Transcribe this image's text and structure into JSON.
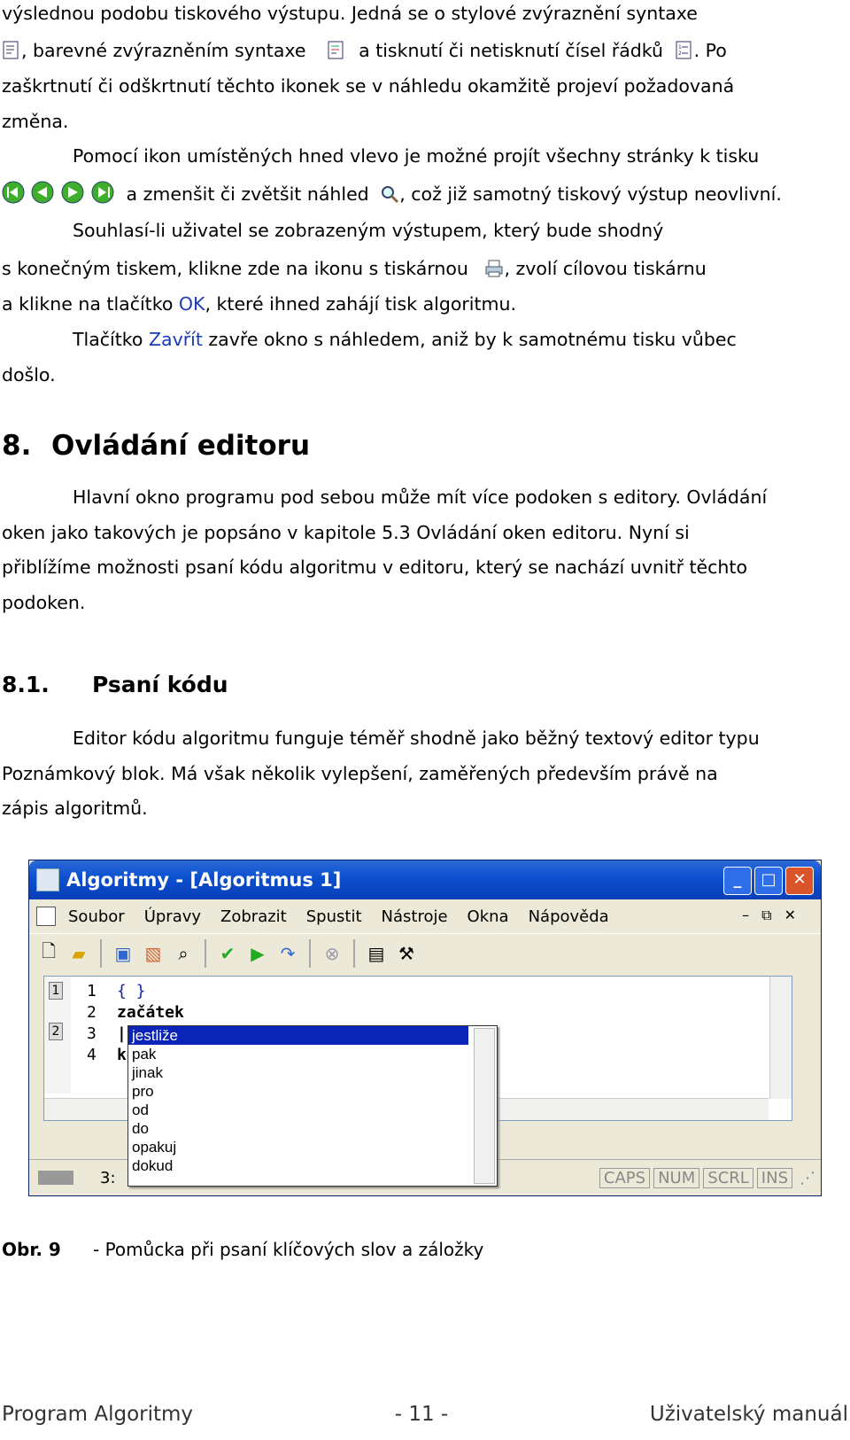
{
  "paragraph_top": {
    "l1": "výslednou podobu tiskového výstupu. Jedná se o stylové zvýraznění syntaxe",
    "l2a": ", barevné zvýrazněním syntaxe",
    "l2b": "a tisknutí či netisknutí čísel řádků",
    "l2c": ". Po",
    "l3": "zaškrtnutí či odškrtnutí těchto ikonek se v náhledu okamžitě projeví požadovaná",
    "l4": "změna."
  },
  "paragraph_pages": {
    "l1": "Pomocí ikon umístěných hned vlevo je možné projít všechny stránky k tisku",
    "l2a": "a zmenšit či zvětšit náhled",
    "l2b": ", což již samotný tiskový výstup neovlivní."
  },
  "paragraph_print": {
    "l1": "Souhlasí-li uživatel se zobrazeným výstupem, který bude shodný",
    "l2a": "s konečným tiskem, klikne zde na ikonu s tiskárnou",
    "l2b": ", zvolí cílovou tiskárnu",
    "l3a": "a klikne na tlačítko ",
    "l3b": "OK",
    "l3c": ", které ihned zahájí tisk algoritmu."
  },
  "paragraph_close": {
    "l1a": "Tlačítko ",
    "l1b": "Zavřít",
    "l1c": " zavře okno s náhledem, aniž by k samotnému tisku vůbec",
    "l2": "došlo."
  },
  "heading1": {
    "num": "8.",
    "title": "Ovládání editoru"
  },
  "paragraph_editor": {
    "l1": "Hlavní okno programu pod sebou může mít více podoken s editory. Ovládání",
    "l2": "oken jako takových je popsáno v kapitole 5.3 Ovládání oken editoru. Nyní si",
    "l3": "přiblížíme možnosti psaní kódu algoritmu v editoru, který se nachází uvnitř těchto",
    "l4": "podoken."
  },
  "heading2": {
    "num": "8.1.",
    "title": "Psaní kódu"
  },
  "paragraph_code": {
    "l1": "Editor kódu algoritmu funguje téměř shodně jako běžný textový editor typu",
    "l2": "Poznámkový blok. Má však několik vylepšení, zaměřených především právě na",
    "l3": "zápis algoritmů."
  },
  "window": {
    "title": "Algoritmy - [Algoritmus 1]",
    "menu": [
      "Soubor",
      "Úpravy",
      "Zobrazit",
      "Spustit",
      "Nástroje",
      "Okna",
      "Nápověda"
    ],
    "marks": [
      "1",
      "2"
    ],
    "lines": [
      {
        "n": "1",
        "code": "{ }"
      },
      {
        "n": "2",
        "code": "začátek"
      },
      {
        "n": "3",
        "code": ""
      },
      {
        "n": "4",
        "code": "ko"
      }
    ],
    "status": {
      "pos": "3:",
      "caps": "CAPS",
      "num": "NUM",
      "scrl": "SCRL",
      "ins": "INS"
    },
    "popup": [
      "jestliže",
      "pak",
      "jinak",
      "pro",
      "od",
      "do",
      "opakuj",
      "dokud"
    ]
  },
  "caption": {
    "label": "Obr. 9",
    "text": "-  Pomůcka při psaní klíčových slov a záložky"
  },
  "footer": {
    "left": "Program Algoritmy",
    "center": "- 11 -",
    "right": "Uživatelský manuál"
  }
}
